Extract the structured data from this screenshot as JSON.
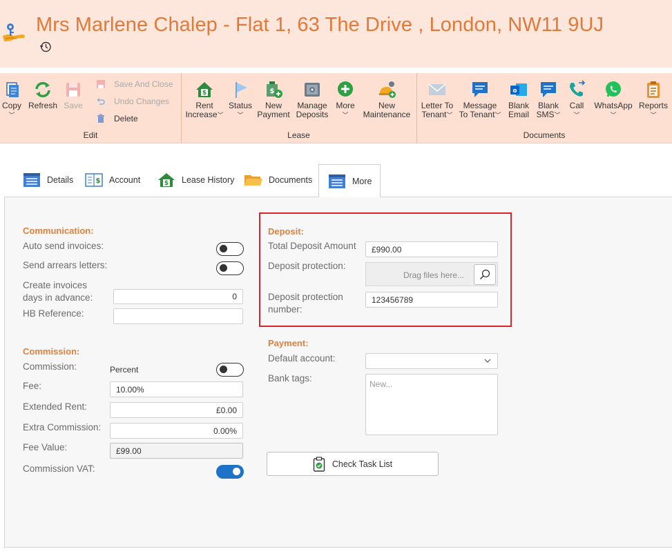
{
  "header": {
    "title": "Mrs Marlene Chalep - Flat 1, 63 The Drive , London, NW11 9UJ"
  },
  "ribbon": {
    "groups": {
      "edit": "Edit",
      "lease": "Lease",
      "documents": "Documents"
    },
    "copy": "Copy",
    "refresh": "Refresh",
    "save": "Save",
    "save_and_close": "Save And Close",
    "undo_changes": "Undo Changes",
    "delete": "Delete",
    "rent_increase_1": "Rent",
    "rent_increase_2": "Increase",
    "status": "Status",
    "new_payment_1": "New",
    "new_payment_2": "Payment",
    "manage_deposits_1": "Manage",
    "manage_deposits_2": "Deposits",
    "more": "More",
    "new_maintenance_1": "New",
    "new_maintenance_2": "Maintenance",
    "letter_to_tenant_1": "Letter To",
    "letter_to_tenant_2": "Tenant",
    "message_to_tenant_1": "Message",
    "message_to_tenant_2": "To Tenant",
    "blank_email_1": "Blank",
    "blank_email_2": "Email",
    "blank_sms_1": "Blank",
    "blank_sms_2": "SMS",
    "call": "Call",
    "whatsapp": "WhatsApp",
    "reports": "Reports"
  },
  "tabs": [
    {
      "label": "Details"
    },
    {
      "label": "Account"
    },
    {
      "label": "Lease History"
    },
    {
      "label": "Documents"
    },
    {
      "label": "More"
    }
  ],
  "communication": {
    "title": "Communication:",
    "auto_send_invoices": "Auto send invoices:",
    "auto_send_invoices_on": false,
    "send_arrears_letters": "Send arrears letters:",
    "send_arrears_letters_on": false,
    "create_invoices_1": "Create invoices",
    "create_invoices_2": "days in advance:",
    "create_invoices_value": "0",
    "hb_reference": "HB Reference:",
    "hb_reference_value": ""
  },
  "commission": {
    "title": "Commission:",
    "commission_label": "Commission:",
    "commission_mode": "Percent",
    "commission_on": false,
    "fee_label": "Fee:",
    "fee_value": "10.00%",
    "extended_rent_label": "Extended Rent:",
    "extended_rent_value": "£0.00",
    "extra_commission_label": "Extra Commission:",
    "extra_commission_value": "0.00%",
    "fee_value_label": "Fee Value:",
    "fee_value_value": "£99.00",
    "commission_vat_label": "Commission VAT:",
    "commission_vat_on": true
  },
  "deposit": {
    "title": "Deposit:",
    "total_label": "Total Deposit Amount",
    "total_value": "£990.00",
    "protection_label": "Deposit protection:",
    "drop_placeholder": "Drag files here...",
    "protection_number_1": "Deposit protection",
    "protection_number_2": "number:",
    "protection_number_value": "123456789"
  },
  "payment": {
    "title": "Payment:",
    "default_account_label": "Default account:",
    "default_account_value": "",
    "bank_tags_label": "Bank tags:",
    "bank_tags_placeholder": "New..."
  },
  "actions": {
    "check_task_list": "Check Task List"
  },
  "colors": {
    "accent": "#e0813d",
    "header_bg": "#fde7dc",
    "ribbon_bg": "#fde0d2",
    "toggle_on": "#1e73c8",
    "highlight": "#d9242a"
  }
}
